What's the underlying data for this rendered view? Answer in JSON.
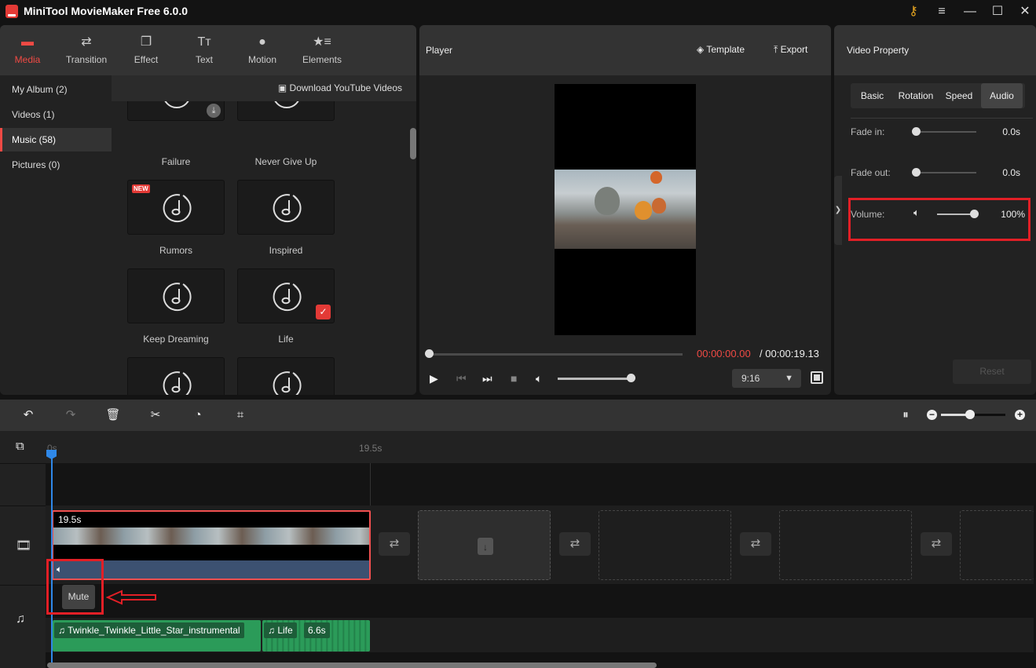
{
  "app": {
    "title": "MiniTool MovieMaker Free 6.0.0",
    "window_controls": [
      "key-icon",
      "menu-icon",
      "minimize-icon",
      "maximize-icon",
      "close-icon"
    ]
  },
  "media_tabs": [
    {
      "label": "Media",
      "icon": "folder-icon",
      "active": true
    },
    {
      "label": "Transition",
      "icon": "transition-icon"
    },
    {
      "label": "Effect",
      "icon": "effect-icon"
    },
    {
      "label": "Text",
      "icon": "text-icon"
    },
    {
      "label": "Motion",
      "icon": "motion-icon"
    },
    {
      "label": "Elements",
      "icon": "elements-icon"
    }
  ],
  "sidebar": {
    "items": [
      {
        "label": "My Album (2)"
      },
      {
        "label": "Videos (1)"
      },
      {
        "label": "Music (58)",
        "active": true
      },
      {
        "label": "Pictures (0)"
      }
    ]
  },
  "media": {
    "download_label": "Download YouTube Videos",
    "cards": [
      {
        "label": "Failure",
        "badge": "download"
      },
      {
        "label": "Never Give Up"
      },
      {
        "label": "Rumors",
        "badge": "NEW"
      },
      {
        "label": "Inspired"
      },
      {
        "label": "Keep Dreaming"
      },
      {
        "label": "Life",
        "selected": true
      },
      {
        "label": ""
      },
      {
        "label": ""
      }
    ]
  },
  "player": {
    "title": "Player",
    "template_label": "Template",
    "export_label": "Export",
    "time_current": "00:00:00.00",
    "time_separator": " / ",
    "time_total": "00:00:19.13",
    "progress": 0,
    "volume": 1.0,
    "aspect_ratio": "9:16"
  },
  "property": {
    "title": "Video Property",
    "tabs": [
      {
        "label": "Basic"
      },
      {
        "label": "Rotation"
      },
      {
        "label": "Speed"
      },
      {
        "label": "Audio",
        "active": true
      }
    ],
    "fade_in": {
      "label": "Fade in:",
      "value": "0.0s",
      "level": 0
    },
    "fade_out": {
      "label": "Fade out:",
      "value": "0.0s",
      "level": 0
    },
    "volume": {
      "label": "Volume:",
      "value": "100%",
      "level": 1.0
    },
    "reset_label": "Reset"
  },
  "timeline": {
    "ruler": {
      "start": "0s",
      "mark": "19.5s"
    },
    "zoom_level": 0.45,
    "video_clip": {
      "duration": "19.5s"
    },
    "mute_label": "Mute",
    "music_clips": [
      {
        "name": "Twinkle_Twinkle_Little_Star_instrumental"
      },
      {
        "name": "Life",
        "duration": "6.6s"
      }
    ]
  },
  "colors": {
    "accent": "#f04a44",
    "playhead": "#2f88e8",
    "music_clip": "#2b9b59",
    "highlight": "#e21f26"
  }
}
